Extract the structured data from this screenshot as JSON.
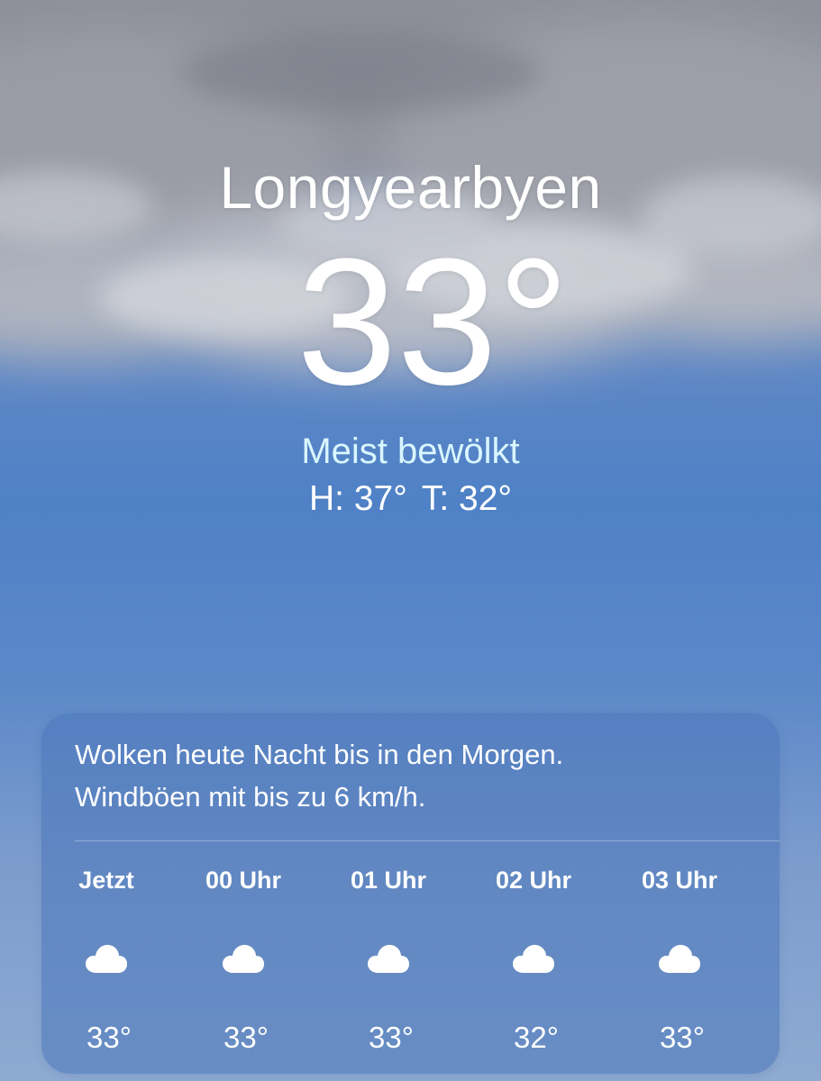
{
  "location": {
    "city": "Longyearbyen",
    "temperature": "33°",
    "condition": "Meist bewölkt",
    "high": "H: 37°",
    "low": "T: 32°"
  },
  "forecast_card": {
    "summary_line1": "Wolken heute Nacht bis in den Morgen.",
    "summary_line2": "Windböen mit bis zu 6 km/h.",
    "hours": [
      {
        "label": "Jetzt",
        "icon": "cloud-icon",
        "temp": "33°"
      },
      {
        "label": "00 Uhr",
        "icon": "cloud-icon",
        "temp": "33°"
      },
      {
        "label": "01 Uhr",
        "icon": "cloud-icon",
        "temp": "33°"
      },
      {
        "label": "02 Uhr",
        "icon": "cloud-icon",
        "temp": "32°"
      },
      {
        "label": "03 Uhr",
        "icon": "cloud-icon",
        "temp": "33°"
      }
    ]
  },
  "colors": {
    "condition_text": "#d9f6ff",
    "sky_top": "#7d8fae",
    "sky_mid": "#4f81c6",
    "sky_bottom": "#8eaad2"
  }
}
